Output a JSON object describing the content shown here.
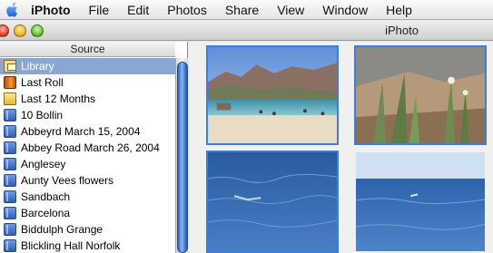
{
  "menubar": {
    "apple_icon": "apple-logo-icon",
    "app_name": "iPhoto",
    "items": [
      "File",
      "Edit",
      "Photos",
      "Share",
      "View",
      "Window",
      "Help"
    ]
  },
  "window": {
    "title": "iPhoto"
  },
  "sidebar": {
    "header": "Source",
    "items": [
      {
        "label": "Library",
        "icon": "library-icon",
        "selected": true
      },
      {
        "label": "Last Roll",
        "icon": "film-roll-icon"
      },
      {
        "label": "Last 12 Months",
        "icon": "calendar-icon"
      },
      {
        "label": "10 Bollin",
        "icon": "album-icon"
      },
      {
        "label": "Abbeyrd March 15, 2004",
        "icon": "album-icon"
      },
      {
        "label": "Abbey Road March 26, 2004",
        "icon": "album-icon"
      },
      {
        "label": "Anglesey",
        "icon": "album-icon"
      },
      {
        "label": "Aunty Vees flowers",
        "icon": "album-icon"
      },
      {
        "label": "Sandbach",
        "icon": "album-icon"
      },
      {
        "label": "Barcelona",
        "icon": "album-icon"
      },
      {
        "label": "Biddulph Grange",
        "icon": "album-icon"
      },
      {
        "label": "Blickling Hall Norfolk",
        "icon": "album-icon"
      }
    ]
  },
  "colors": {
    "selection": "#8aa7cf",
    "photo_border": "#3f7ed8",
    "scroll_thumb": "#4f86d6"
  }
}
